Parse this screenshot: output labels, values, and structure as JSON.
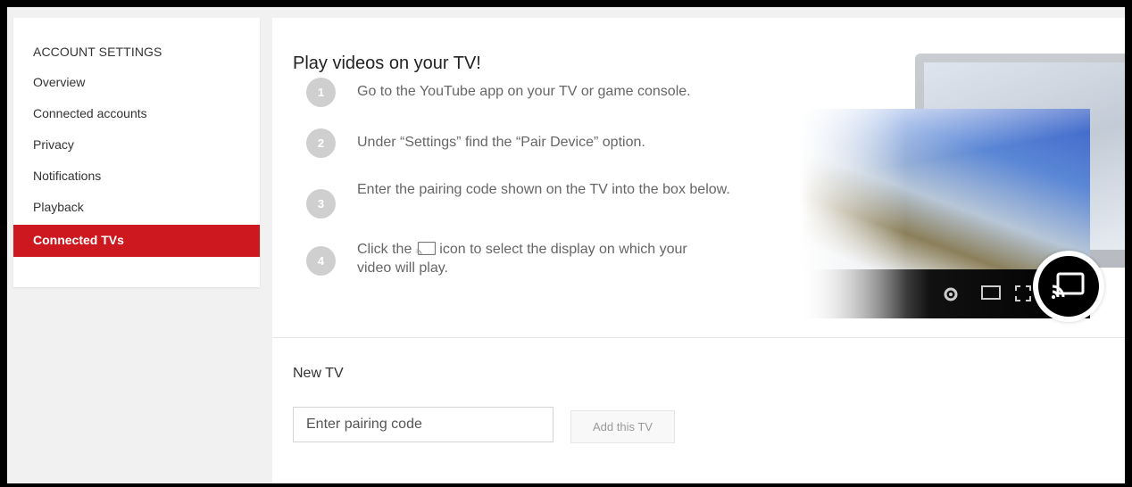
{
  "sidebar": {
    "heading": "ACCOUNT SETTINGS",
    "items": [
      {
        "label": "Overview",
        "active": false
      },
      {
        "label": "Connected accounts",
        "active": false
      },
      {
        "label": "Privacy",
        "active": false
      },
      {
        "label": "Notifications",
        "active": false
      },
      {
        "label": "Playback",
        "active": false
      },
      {
        "label": "Connected TVs",
        "active": true
      }
    ]
  },
  "intro": {
    "title": "Play videos on your TV!",
    "steps": [
      {
        "num": "1",
        "text": "Go to the YouTube app on your TV or game console."
      },
      {
        "num": "2",
        "text": "Under “Settings” find the “Pair Device” option."
      },
      {
        "num": "3",
        "text": "Enter the pairing code shown on the TV into the box below."
      },
      {
        "num": "4",
        "text_before": "Click the",
        "text_after": "icon to select the display on which your video will play."
      }
    ]
  },
  "new_tv": {
    "title": "New TV",
    "input_placeholder": "Enter pairing code",
    "input_value": "",
    "button_label": "Add this TV"
  },
  "colors": {
    "accent": "#cc181e",
    "step_circle": "#cfcfcf"
  },
  "icons": {
    "inline_step_icon": "cast-icon",
    "illustration_icons": [
      "gear-icon",
      "theater-mode-icon",
      "fullscreen-icon",
      "cast-icon"
    ]
  }
}
